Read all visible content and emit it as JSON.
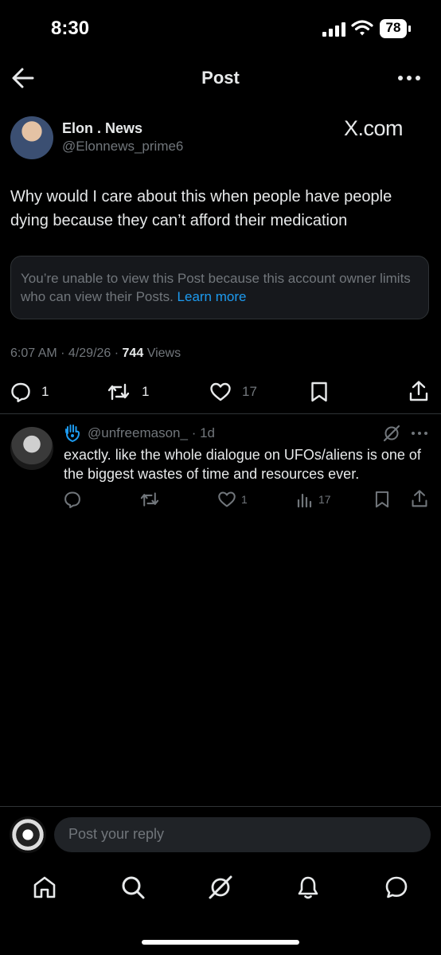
{
  "status_bar": {
    "time": "8:30",
    "battery": "78"
  },
  "header": {
    "title": "Post"
  },
  "post": {
    "display_name": "Elon . News",
    "handle": "@Elonnews_prime6",
    "site_mark": "X.com",
    "text": "Why would I care about this when people have people dying because they can’t afford their medication",
    "notice": {
      "text": "You’re unable to view this Post because this account owner limits who can view their Posts. ",
      "link": "Learn more"
    },
    "time": "6:07 AM",
    "date": "4/29/26",
    "views_count": "744",
    "views_label": "Views",
    "replies": "1",
    "reposts": "1",
    "likes": "17"
  },
  "reply": {
    "handle": "@unfreemason_",
    "age": "· 1d",
    "text": "exactly. like the whole dialogue on UFOs/aliens is one of the biggest wastes of time and resources ever.",
    "likes": "1",
    "views": "17"
  },
  "composer": {
    "placeholder": "Post your reply"
  },
  "icons": {
    "back": "back-arrow-icon",
    "more": "more-icon",
    "reply": "reply-icon",
    "repost": "repost-icon",
    "like": "like-icon",
    "bookmark": "bookmark-icon",
    "share": "share-icon",
    "views": "views-icon",
    "grok": "grok-icon",
    "home": "home-icon",
    "search": "search-icon",
    "notifications": "bell-icon",
    "messages": "messages-icon"
  },
  "colors": {
    "background": "#000000",
    "text": "#e7e9ea",
    "secondary": "#71767b",
    "link": "#1d9bf0"
  }
}
